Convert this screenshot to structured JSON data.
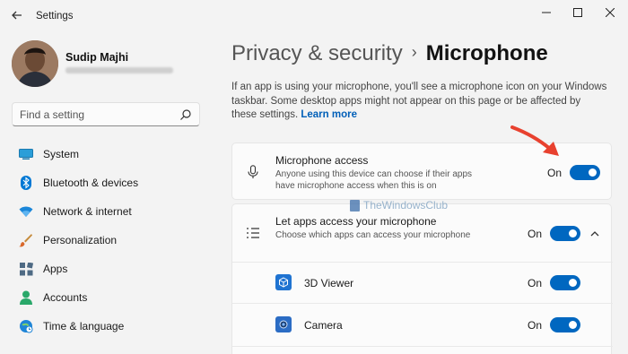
{
  "window": {
    "title": "Settings",
    "controls": {
      "minimize": "—",
      "maximize": "☐",
      "close": "✕"
    }
  },
  "profile": {
    "name": "Sudip Majhi"
  },
  "search": {
    "placeholder": "Find a setting"
  },
  "nav": [
    {
      "label": "System",
      "icon": "system-icon"
    },
    {
      "label": "Bluetooth & devices",
      "icon": "bluetooth-icon"
    },
    {
      "label": "Network & internet",
      "icon": "network-icon"
    },
    {
      "label": "Personalization",
      "icon": "personalization-icon"
    },
    {
      "label": "Apps",
      "icon": "apps-icon"
    },
    {
      "label": "Accounts",
      "icon": "accounts-icon"
    },
    {
      "label": "Time & language",
      "icon": "time-language-icon"
    }
  ],
  "breadcrumb": {
    "parent": "Privacy & security",
    "separator": "›",
    "current": "Microphone"
  },
  "description": {
    "text": "If an app is using your microphone, you'll see a microphone icon on your Windows taskbar. Some desktop apps might not appear on this page or be affected by these settings.",
    "link": "Learn more"
  },
  "microphone_access": {
    "title": "Microphone access",
    "subtitle": "Anyone using this device can choose if their apps have microphone access when this is on",
    "state": "On",
    "enabled": true
  },
  "apps_access": {
    "title": "Let apps access your microphone",
    "subtitle": "Choose which apps can access your microphone",
    "state": "On",
    "enabled": true,
    "expanded": true
  },
  "apps": [
    {
      "name": "3D Viewer",
      "state": "On",
      "enabled": true,
      "icon": "cube-icon"
    },
    {
      "name": "Camera",
      "state": "On",
      "enabled": true,
      "icon": "camera-icon"
    }
  ],
  "watermark": {
    "text": "TheWindowsClub"
  },
  "colors": {
    "accent": "#0067c0",
    "link": "#005fb8",
    "background": "#f3f3f3",
    "card": "#fbfbfb",
    "arrow": "#e8412f"
  }
}
